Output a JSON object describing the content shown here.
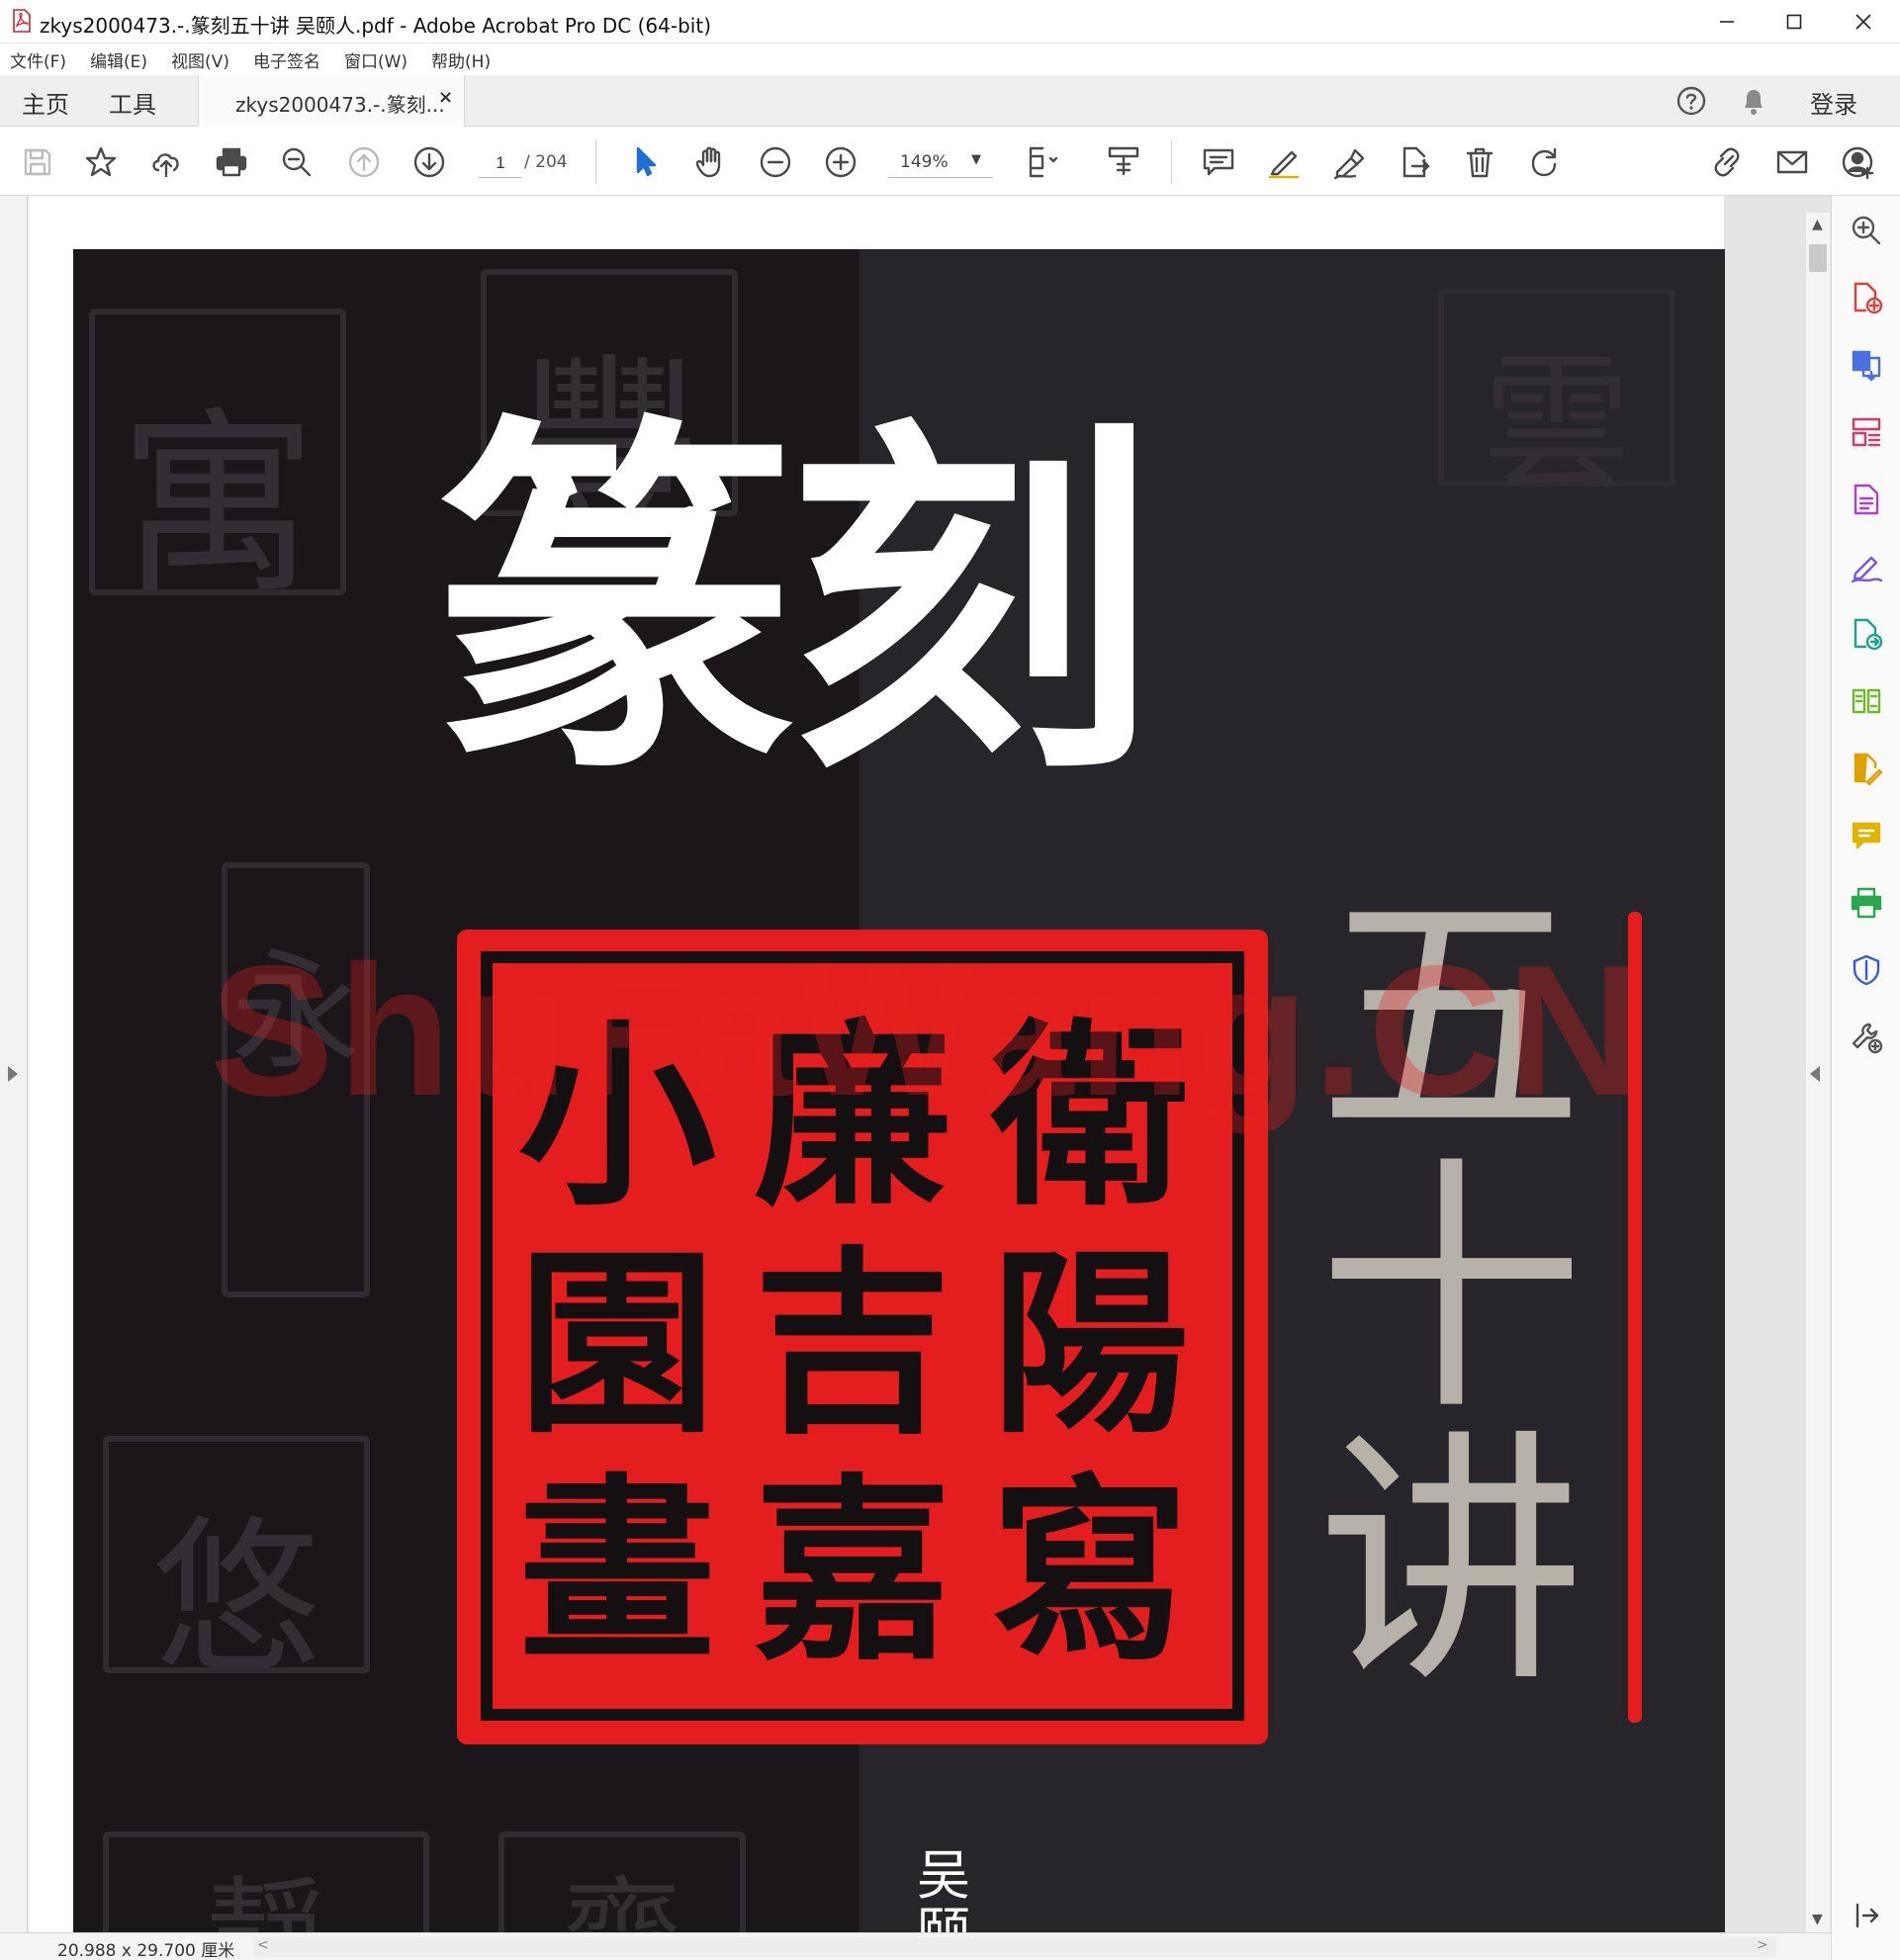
{
  "window": {
    "title": "zkys2000473.-.篆刻五十讲 吴颐人.pdf - Adobe Acrobat Pro DC (64-bit)",
    "app_icon": "acrobat-icon",
    "controls": [
      "minimize-icon",
      "maximize-icon",
      "close-icon"
    ]
  },
  "menu": {
    "items": [
      "文件(F)",
      "编辑(E)",
      "视图(V)",
      "电子签名",
      "窗口(W)",
      "帮助(H)"
    ]
  },
  "tabs": {
    "home": "主页",
    "tools": "工具",
    "document": "zkys2000473.-.篆刻...",
    "close_glyph": "×",
    "login": "登录",
    "help_icon": "help-icon",
    "bell_icon": "bell-icon"
  },
  "toolbar": {
    "page_current": "1",
    "page_total": "/ 204",
    "zoom": "149%",
    "zoom_caret": "▼",
    "icons": [
      "save-icon",
      "star-icon",
      "upload-icon",
      "print-icon",
      "find-icon",
      "prev-page-icon",
      "next-page-icon",
      "select-arrow-icon",
      "hand-icon",
      "zoom-out-icon",
      "zoom-in-icon",
      "fit-page-icon",
      "scroll-mode-icon",
      "comment-icon",
      "highlight-icon",
      "sign-icon",
      "export-icon",
      "delete-icon",
      "rotate-icon",
      "share-link-icon",
      "email-icon",
      "add-user-icon"
    ]
  },
  "document": {
    "cover_title": "篆刻",
    "cover_subtitle": "五十讲",
    "author": "吴颐",
    "seal_glyphs_left": [
      "小",
      "園",
      "畫"
    ],
    "seal_glyphs_mid": [
      "廉",
      "吉",
      "嘉"
    ],
    "seal_glyphs_right": [
      "衛",
      "陽",
      "寫"
    ],
    "faint_seals": [
      "寓",
      "豐",
      "永",
      "悠",
      "靜",
      "齋",
      "雲"
    ],
    "watermark": "ShuFaWang.CN"
  },
  "scrollbar": {
    "up": "▲",
    "down": "▼",
    "left": "<",
    "right": ">"
  },
  "status": {
    "page_size": "20.988 x 29.700 厘米"
  },
  "right_pane": {
    "tools": [
      {
        "icon": "zoom-search-icon",
        "color": "#555555"
      },
      {
        "icon": "create-pdf-icon",
        "color": "#e0403a"
      },
      {
        "icon": "combine-files-icon",
        "color": "#4c6fe0"
      },
      {
        "icon": "organize-pages-icon",
        "color": "#d9386b"
      },
      {
        "icon": "export-pdf-icon",
        "color": "#b03fd0"
      },
      {
        "icon": "fill-sign-icon",
        "color": "#7a57d6"
      },
      {
        "icon": "send-review-icon",
        "color": "#1aa38c"
      },
      {
        "icon": "compare-files-icon",
        "color": "#6fba2c"
      },
      {
        "icon": "edit-pdf-icon",
        "color": "#e1a100"
      },
      {
        "icon": "comment-tool-icon",
        "color": "#e1b400"
      },
      {
        "icon": "print-production-icon",
        "color": "#2aa64f"
      },
      {
        "icon": "protect-icon",
        "color": "#3b5bd6"
      },
      {
        "icon": "more-tools-icon",
        "color": "#555555"
      }
    ],
    "collapse_icon": "collapse-pane-icon"
  }
}
